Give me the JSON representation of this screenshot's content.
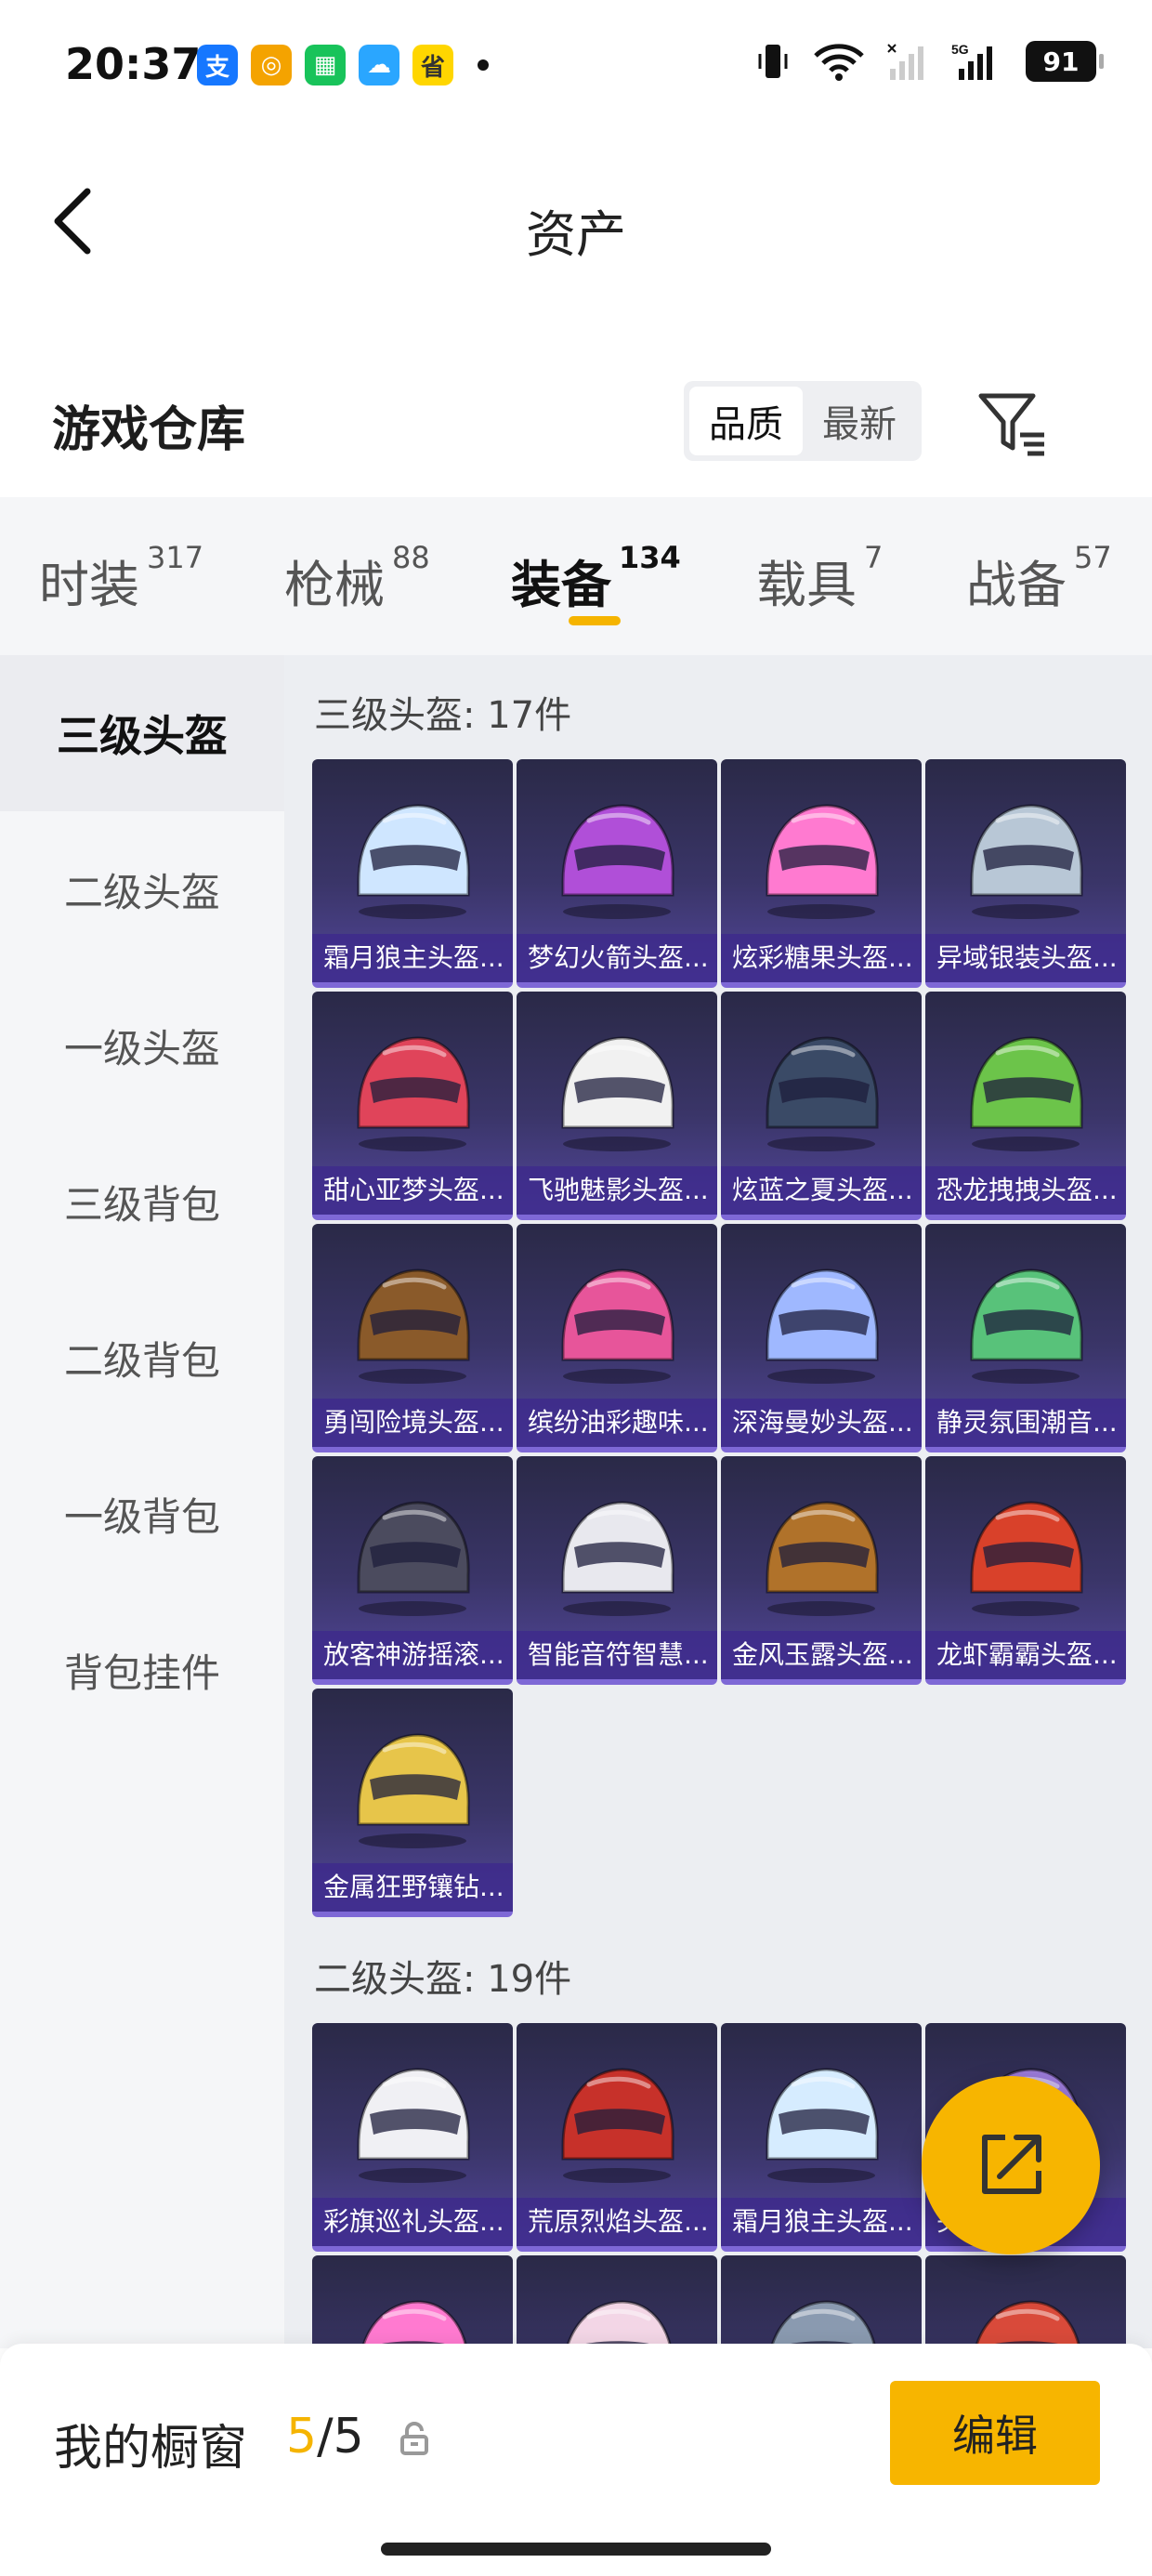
{
  "status_bar": {
    "time": "20:37",
    "apps": [
      {
        "icon": "alipay-icon",
        "glyph": "支",
        "color": "#1677ff"
      },
      {
        "icon": "music-app-icon",
        "glyph": "◎",
        "color": "#f4a300"
      },
      {
        "icon": "grid-app-icon",
        "glyph": "▦",
        "color": "#18c35a"
      },
      {
        "icon": "chat-app-icon",
        "glyph": "☁",
        "color": "#2aa6ff"
      },
      {
        "icon": "coupon-app-icon",
        "glyph": "省",
        "color": "#ffd600"
      }
    ],
    "battery": "91",
    "network_label": "5G"
  },
  "nav": {
    "title": "资产"
  },
  "warehouse": {
    "title": "游戏仓库",
    "sort_options": [
      "品质",
      "最新"
    ]
  },
  "tabs": [
    {
      "label": "时装",
      "count": "317"
    },
    {
      "label": "枪械",
      "count": "88"
    },
    {
      "label": "装备",
      "count": "134"
    },
    {
      "label": "载具",
      "count": "7"
    },
    {
      "label": "战备",
      "count": "57"
    }
  ],
  "sidebar": [
    "三级头盔",
    "二级头盔",
    "一级头盔",
    "三级背包",
    "二级背包",
    "一级背包",
    "背包挂件"
  ],
  "sections": [
    {
      "title": "三级头盔: 17件",
      "items": [
        {
          "name": "霜月狼主头盔...",
          "color": "#cfe6ff"
        },
        {
          "name": "梦幻火箭头盔...",
          "color": "#b04fd8"
        },
        {
          "name": "炫彩糖果头盔...",
          "color": "#ff7ad0"
        },
        {
          "name": "异域银装头盔...",
          "color": "#b8c7d6"
        },
        {
          "name": "甜心亚梦头盔...",
          "color": "#e0445a"
        },
        {
          "name": "飞驰魅影头盔...",
          "color": "#f1f1f1"
        },
        {
          "name": "炫蓝之夏头盔...",
          "color": "#3a4a66"
        },
        {
          "name": "恐龙拽拽头盔...",
          "color": "#6cc44a"
        },
        {
          "name": "勇闯险境头盔...",
          "color": "#8a5a2a"
        },
        {
          "name": "缤纷油彩趣味...",
          "color": "#e7559a"
        },
        {
          "name": "深海曼妙头盔...",
          "color": "#9fb8ff"
        },
        {
          "name": "静灵氛围潮音...",
          "color": "#58c27a"
        },
        {
          "name": "放客神游摇滚...",
          "color": "#4b4b5e"
        },
        {
          "name": "智能音符智慧...",
          "color": "#e8e8ee"
        },
        {
          "name": "金风玉露头盔...",
          "color": "#b0722a"
        },
        {
          "name": "龙虾霸霸头盔...",
          "color": "#d9412a"
        },
        {
          "name": "金属狂野镶钻...",
          "color": "#e7c54a"
        }
      ]
    },
    {
      "title": "二级头盔: 19件",
      "items": [
        {
          "name": "彩旗巡礼头盔...",
          "color": "#f0f0f4"
        },
        {
          "name": "荒原烈焰头盔...",
          "color": "#c7312a"
        },
        {
          "name": "霜月狼主头盔...",
          "color": "#d6ecff"
        },
        {
          "name": "头盔...",
          "color": "#9a7ad8"
        },
        {
          "name": "",
          "color": "#ff7ad0"
        },
        {
          "name": "",
          "color": "#f3d6e6"
        },
        {
          "name": "",
          "color": "#8a9ab0"
        },
        {
          "name": "",
          "color": "#d94a3a"
        }
      ]
    }
  ],
  "footer": {
    "label": "我的橱窗",
    "current": "5",
    "separator": "/",
    "total": "5",
    "edit_label": "编辑"
  }
}
